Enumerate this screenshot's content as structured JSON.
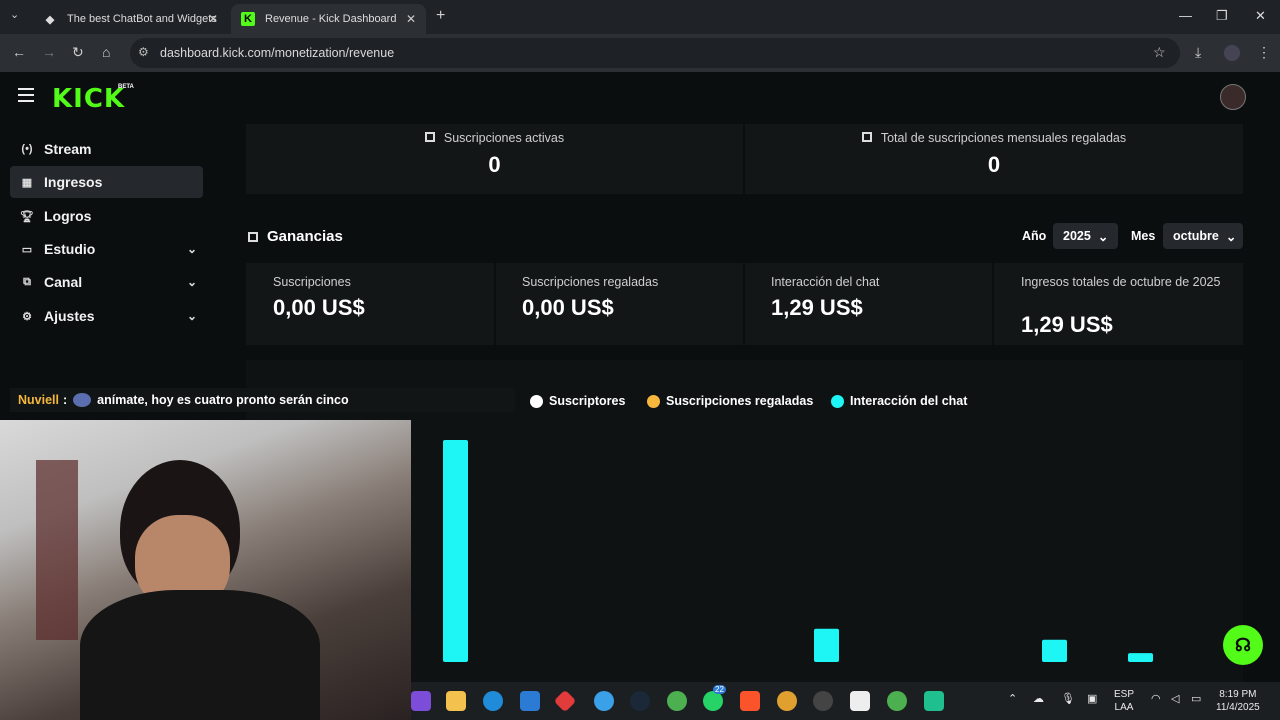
{
  "browser": {
    "tabs": [
      {
        "title": "The best ChatBot and Widgets",
        "active": false
      },
      {
        "title": "Revenue - Kick Dashboard",
        "active": true
      }
    ],
    "url": "dashboard.kick.com/monetization/revenue"
  },
  "app": {
    "logo": "KICK",
    "logo_badge": "BETA"
  },
  "sidebar": {
    "items": [
      {
        "label": "Stream",
        "icon": "broadcast-icon"
      },
      {
        "label": "Ingresos",
        "icon": "chart-icon",
        "active": true
      },
      {
        "label": "Logros",
        "icon": "trophy-icon"
      },
      {
        "label": "Estudio",
        "icon": "studio-icon",
        "expandable": true
      },
      {
        "label": "Canal",
        "icon": "channel-icon",
        "expandable": true
      },
      {
        "label": "Ajustes",
        "icon": "gear-icon",
        "expandable": true
      }
    ]
  },
  "top_stats": [
    {
      "label": "Suscripciones activas",
      "value": "0"
    },
    {
      "label": "Total de suscripciones mensuales regaladas",
      "value": "0"
    }
  ],
  "earnings": {
    "title": "Ganancias",
    "year_label": "Año",
    "year_value": "2025",
    "month_label": "Mes",
    "month_value": "octubre",
    "cards": [
      {
        "label": "Suscripciones",
        "value": "0,00 US$"
      },
      {
        "label": "Suscripciones regaladas",
        "value": "0,00 US$"
      },
      {
        "label": "Interacción del chat",
        "value": "1,29 US$"
      },
      {
        "label": "Ingresos totales de octubre de 2025",
        "value": "1,29 US$"
      }
    ]
  },
  "chart_legend": [
    {
      "label": "Suscriptores",
      "color": "#ffffff"
    },
    {
      "label": "Suscripciones regaladas",
      "color": "#f6b73c"
    },
    {
      "label": "Interacción del chat",
      "color": "#1ef6f6"
    }
  ],
  "chart_data": {
    "type": "bar",
    "series": [
      {
        "name": "Interacción del chat",
        "color": "#1ef6f6",
        "values": [
          1.0,
          0.15,
          0.1,
          0.04
        ]
      }
    ]
  },
  "chat_overlay": {
    "user": "Nuviell",
    "separator": ":",
    "message": "anímate, hoy es cuatro pronto serán cinco"
  },
  "taskbar": {
    "language": "ESP",
    "layout": "LAA",
    "time": "8:19 PM",
    "date": "11/4/2025",
    "whatsapp_badge": "22"
  }
}
